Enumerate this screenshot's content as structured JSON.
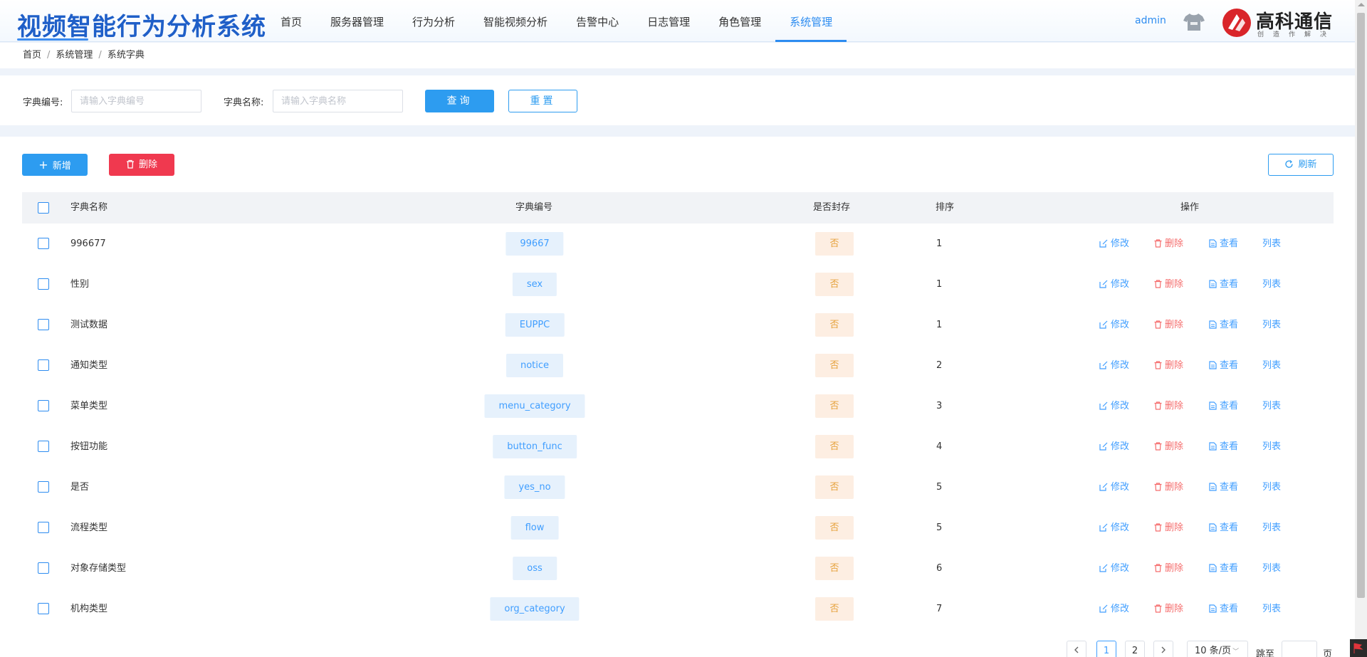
{
  "header": {
    "title": "视频智能行为分析系统",
    "nav": [
      "首页",
      "服务器管理",
      "行为分析",
      "智能视频分析",
      "告警中心",
      "日志管理",
      "角色管理",
      "系统管理"
    ],
    "active_nav_index": 7,
    "user": "admin",
    "logo_text": "高科通信",
    "logo_sub": "创造作解决"
  },
  "breadcrumb": [
    "首页",
    "系统管理",
    "系统字典"
  ],
  "search": {
    "code_label": "字典编号:",
    "code_placeholder": "请输入字典编号",
    "name_label": "字典名称:",
    "name_placeholder": "请输入字典名称",
    "query_label": "查询",
    "reset_label": "重置"
  },
  "toolbar": {
    "add_label": "新增",
    "delete_label": "删除",
    "refresh_label": "刷新"
  },
  "table": {
    "columns": [
      "字典名称",
      "字典编号",
      "是否封存",
      "排序",
      "操作"
    ],
    "rows": [
      {
        "name": "996677",
        "code": "99667",
        "sealed": "否",
        "sort": "1"
      },
      {
        "name": "性别",
        "code": "sex",
        "sealed": "否",
        "sort": "1"
      },
      {
        "name": "测试数据",
        "code": "EUPPC",
        "sealed": "否",
        "sort": "1"
      },
      {
        "name": "通知类型",
        "code": "notice",
        "sealed": "否",
        "sort": "2"
      },
      {
        "name": "菜单类型",
        "code": "menu_category",
        "sealed": "否",
        "sort": "3"
      },
      {
        "name": "按钮功能",
        "code": "button_func",
        "sealed": "否",
        "sort": "4"
      },
      {
        "name": "是否",
        "code": "yes_no",
        "sealed": "否",
        "sort": "5"
      },
      {
        "name": "流程类型",
        "code": "flow",
        "sealed": "否",
        "sort": "5"
      },
      {
        "name": "对象存储类型",
        "code": "oss",
        "sealed": "否",
        "sort": "6"
      },
      {
        "name": "机构类型",
        "code": "org_category",
        "sealed": "否",
        "sort": "7"
      }
    ],
    "actions": {
      "edit": "修改",
      "delete": "删除",
      "view": "查看",
      "list": "列表"
    }
  },
  "pagination": {
    "pages": [
      "1",
      "2"
    ],
    "current": "1",
    "page_size": "10 条/页",
    "jump_label": "跳至",
    "page_unit": "页"
  },
  "colors": {
    "primary": "#2d9cf0",
    "danger": "#f0394f",
    "brand": "#1f5fc8"
  }
}
